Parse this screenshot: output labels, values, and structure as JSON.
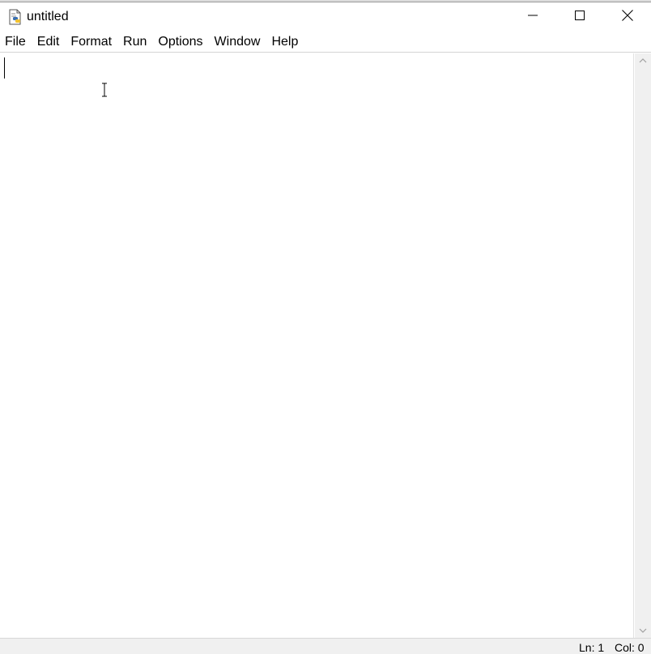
{
  "window": {
    "title": "untitled",
    "icons": {
      "app": "python-file-icon",
      "minimize": "minimize-icon",
      "maximize": "maximize-icon",
      "close": "close-icon"
    }
  },
  "menubar": {
    "items": [
      {
        "label": "File"
      },
      {
        "label": "Edit"
      },
      {
        "label": "Format"
      },
      {
        "label": "Run"
      },
      {
        "label": "Options"
      },
      {
        "label": "Window"
      },
      {
        "label": "Help"
      }
    ]
  },
  "editor": {
    "content": ""
  },
  "statusbar": {
    "line": "Ln: 1",
    "column": "Col: 0"
  },
  "colors": {
    "background": "#ffffff",
    "statusbar": "#f0f0f0",
    "scrollbar": "#f0f0f0",
    "text": "#000000"
  }
}
